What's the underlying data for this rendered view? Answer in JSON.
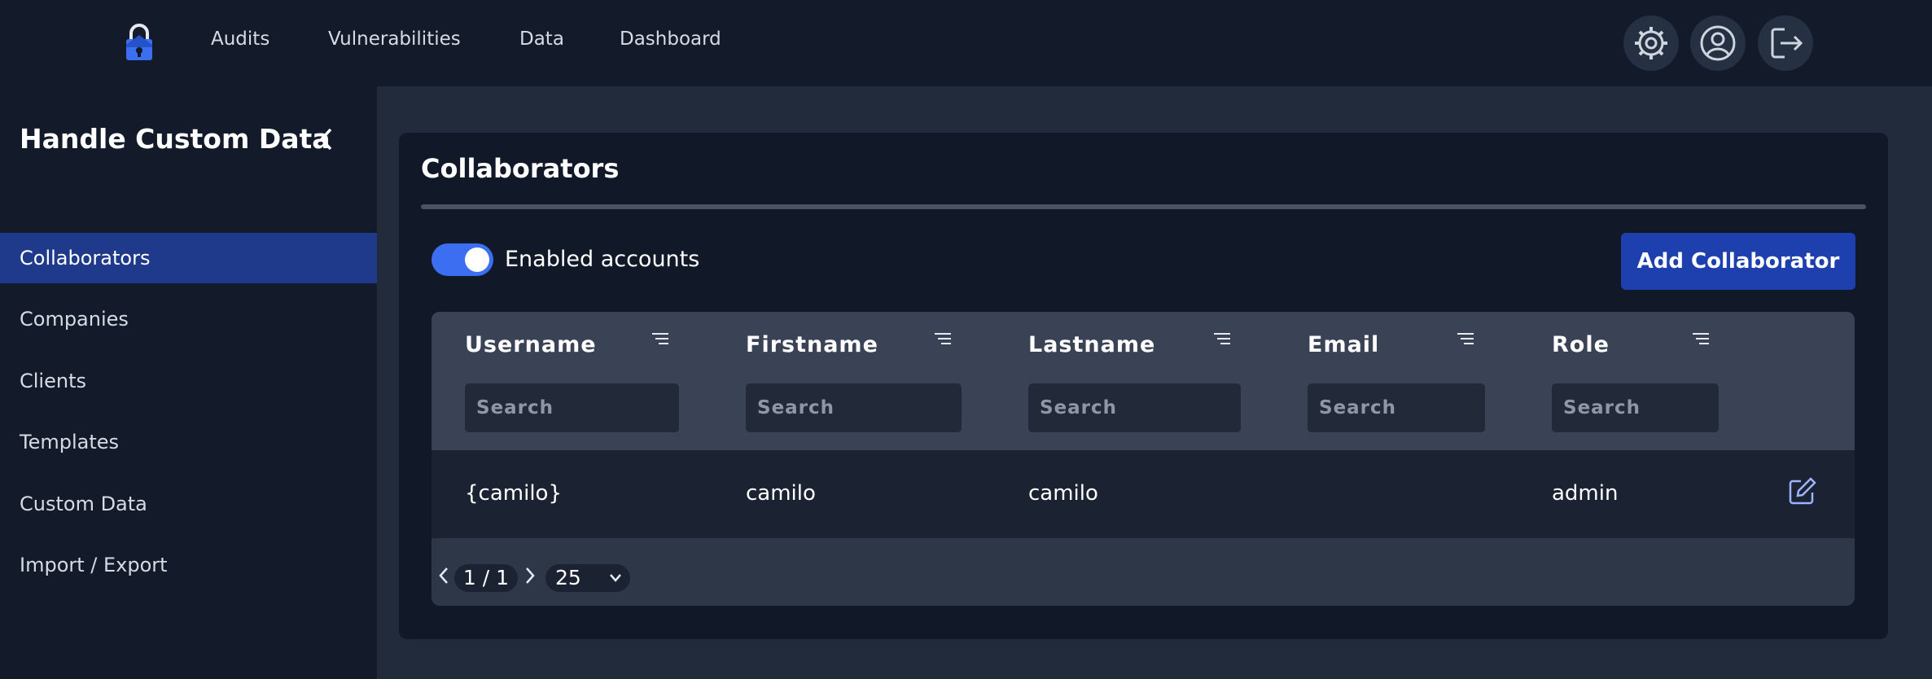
{
  "nav": {
    "links": [
      "Audits",
      "Vulnerabilities",
      "Data",
      "Dashboard"
    ],
    "icons": [
      "gear-icon",
      "user-icon",
      "logout-icon"
    ]
  },
  "sidebar": {
    "title": "Handle Custom Data",
    "items": [
      {
        "label": "Collaborators",
        "active": true
      },
      {
        "label": "Companies",
        "active": false
      },
      {
        "label": "Clients",
        "active": false
      },
      {
        "label": "Templates",
        "active": false
      },
      {
        "label": "Custom Data",
        "active": false
      },
      {
        "label": "Import / Export",
        "active": false
      }
    ]
  },
  "main": {
    "title": "Collaborators",
    "toggle_label": "Enabled accounts",
    "toggle_on": true,
    "add_button": "Add Collaborator",
    "table": {
      "columns": [
        "Username",
        "Firstname",
        "Lastname",
        "Email",
        "Role"
      ],
      "search_placeholder": "Search",
      "rows": [
        {
          "username": "{camilo}",
          "firstname": "camilo",
          "lastname": "camilo",
          "email": "",
          "role": "admin"
        }
      ]
    },
    "pagination": {
      "page": "1 / 1",
      "page_size": "25"
    }
  },
  "colors": {
    "accent": "#3b6ef0",
    "button": "#1e40af",
    "active_item": "#1f3a8a"
  }
}
